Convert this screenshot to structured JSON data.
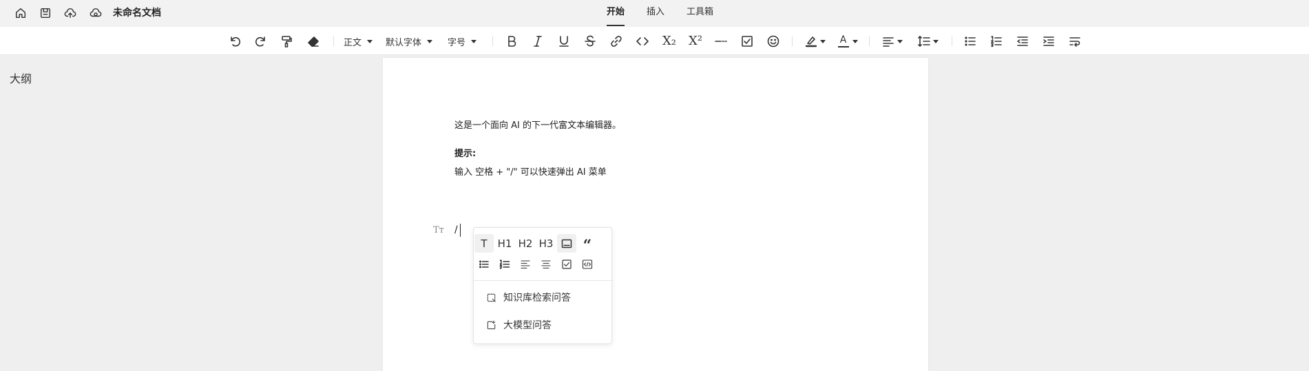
{
  "header": {
    "doc_title": "未命名文档",
    "tabs": [
      {
        "label": "开始"
      },
      {
        "label": "插入"
      },
      {
        "label": "工具箱"
      }
    ],
    "active_tab": "开始",
    "icons": [
      "home-icon",
      "save-icon",
      "cloud-upload-icon",
      "cloud-sync-icon"
    ]
  },
  "toolbar": {
    "paragraph_style": "正文",
    "font_family": "默认字体",
    "font_size": "字号",
    "subscript_label": "X₂",
    "superscript_label": "X²",
    "text_color_letter": "A"
  },
  "outline": {
    "label": "大纲"
  },
  "document": {
    "intro": "这是一个面向 AI 的下一代富文本编辑器。",
    "tip_label": "提示:",
    "tip_text": "输入 空格 + \"/\" 可以快速弹出 AI 菜单",
    "current_line": "/",
    "block_handle": "Tт"
  },
  "slash_menu": {
    "row1": [
      "T",
      "H1",
      "H2",
      "H3",
      "caption",
      "“"
    ],
    "row2": [
      "bullet-list",
      "ordered-list",
      "align-left",
      "align-center",
      "task-list",
      "code-block"
    ],
    "items": [
      {
        "label": "知识库检索问答",
        "icon": "knowledge-search-icon"
      },
      {
        "label": "大模型问答",
        "icon": "llm-chat-icon"
      }
    ]
  }
}
